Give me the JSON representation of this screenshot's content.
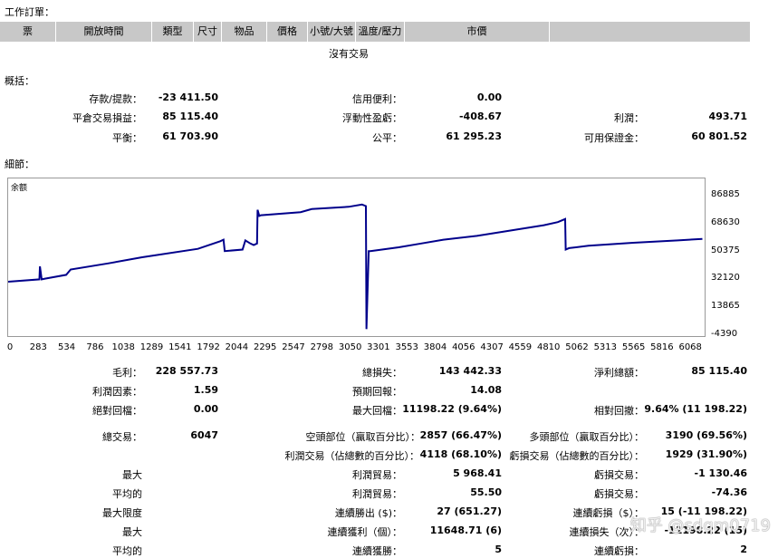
{
  "orders_title": "工作訂單：",
  "columns": [
    "票",
    "開放時間",
    "類型",
    "尺寸",
    "物品",
    "價格",
    "小號/大號",
    "溫度/壓力",
    "市價"
  ],
  "no_trades": "沒有交易",
  "summary_title": "概括：",
  "summary": {
    "deposit_label": "存款/提款：",
    "deposit_value": "-23 411.50",
    "closed_pl_label": "平倉交易損益：",
    "closed_pl_value": "85 115.40",
    "balance_label": "平衡：",
    "balance_value": "61 703.90",
    "credit_label": "信用便利：",
    "credit_value": "0.00",
    "floating_label": "浮動性盈虧：",
    "floating_value": "-408.67",
    "equity_label": "公平：",
    "equity_value": "61 295.23",
    "profit_label": "利潤：",
    "profit_value": "493.71",
    "free_margin_label": "可用保證金：",
    "free_margin_value": "60 801.52"
  },
  "details_title": "細節：",
  "chart_data": {
    "type": "line",
    "title": "余额",
    "y_ticks": [
      "86885",
      "68630",
      "50375",
      "32120",
      "13865",
      "-4390"
    ],
    "x_ticks": [
      "0",
      "283",
      "534",
      "786",
      "1038",
      "1289",
      "1541",
      "1792",
      "2044",
      "2295",
      "2547",
      "2798",
      "3050",
      "3301",
      "3553",
      "3804",
      "4056",
      "4307",
      "4559",
      "4810",
      "5062",
      "5313",
      "5565",
      "5816",
      "6068"
    ],
    "ylim": [
      -4390,
      86885
    ],
    "xlim": [
      0,
      6240
    ],
    "series": [
      {
        "color": "#00008b",
        "x": [
          0,
          280,
          285,
          300,
          330,
          520,
          560,
          900,
          1200,
          1700,
          1900,
          1930,
          1940,
          2100,
          2125,
          2170,
          2200,
          2230,
          2235,
          2250,
          2265,
          2620,
          2720,
          3050,
          3170,
          3205,
          3210,
          3230,
          3245,
          3500,
          3700,
          3900,
          4200,
          4500,
          4800,
          4925,
          4990,
          4995,
          5025,
          5200,
          5600,
          6000,
          6220
        ],
        "y": [
          30000,
          31500,
          40000,
          31500,
          32000,
          34500,
          38000,
          42000,
          46000,
          51500,
          56500,
          57500,
          50000,
          51000,
          57000,
          55000,
          54000,
          55000,
          77000,
          73000,
          73500,
          75500,
          77500,
          79000,
          80500,
          79500,
          -1000,
          50000,
          50000,
          52500,
          55000,
          57500,
          60000,
          63500,
          67000,
          69000,
          71000,
          51000,
          52000,
          53500,
          55500,
          57000,
          58000
        ]
      }
    ]
  },
  "stats": {
    "gross_profit_label": "毛利：",
    "gross_profit_value": "228 557.73",
    "gross_loss_label": "總損失：",
    "gross_loss_value": "143 442.33",
    "net_profit_label": "淨利總額：",
    "net_profit_value": "85 115.40",
    "profit_factor_label": "利潤因素：",
    "profit_factor_value": "1.59",
    "expected_payoff_label": "預期回報：",
    "expected_payoff_value": "14.08",
    "abs_dd_label": "絕對回檔：",
    "abs_dd_value": "0.00",
    "max_dd_label": "最大回檔：",
    "max_dd_value": "11198.22 (9.64%)",
    "rel_dd_label": "相對回撤：",
    "rel_dd_value": "9.64% (11 198.22)",
    "total_trades_label": "總交易：",
    "total_trades_value": "6047",
    "short_label": "空頭部位（贏取百分比）：",
    "short_value": "2857 (66.47%)",
    "long_label": "多頭部位（贏取百分比）：",
    "long_value": "3190 (69.56%)",
    "profit_trades_label": "利潤交易（佔總數的百分比）：",
    "profit_trades_value": "4118 (68.10%)",
    "loss_trades_label": "虧損交易（佔總數的百分比）：",
    "loss_trades_value": "1929 (31.90%)",
    "largest_label": "最大",
    "largest_profit_label": "利潤貿易：",
    "largest_profit_value": "5 968.41",
    "largest_loss_label": "虧損交易：",
    "largest_loss_value": "-1 130.46",
    "average_label": "平均的",
    "avg_profit_label": "利潤貿易：",
    "avg_profit_value": "55.50",
    "avg_loss_label": "虧損交易：",
    "avg_loss_value": "-74.36",
    "max_limit_label": "最大限度",
    "cons_wins_label": "連續勝出 ($)：",
    "cons_wins_value": "27 (651.27)",
    "cons_losses_label": "連續虧損（$）：",
    "cons_losses_value": "15 (-11 198.22)",
    "maximal_label": "最大",
    "cons_profit_label": "連續獲利（個）：",
    "cons_profit_value": "11648.71 (6)",
    "cons_loss_label": "連續損失（次）：",
    "cons_loss_value": "-11198.22 (15)",
    "average2_label": "平均的",
    "avg_cons_wins_label": "連續獲勝：",
    "avg_cons_wins_value": "5",
    "avg_cons_losses_label": "連續虧損：",
    "avg_cons_losses_value": "2"
  },
  "watermark": "知乎 @sdqm0719"
}
